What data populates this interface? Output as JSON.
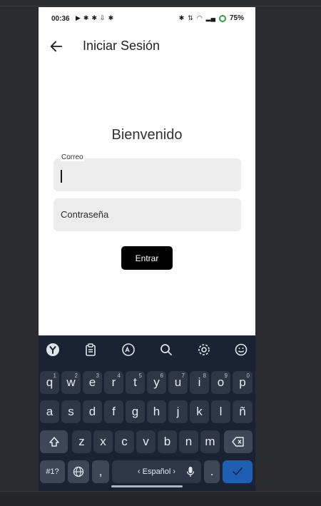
{
  "status": {
    "time": "00:36",
    "battery": "75%"
  },
  "appbar": {
    "title": "Iniciar Sesión"
  },
  "main": {
    "welcome": "Bienvenido",
    "email_label": "Correo",
    "password_placeholder": "Contraseña",
    "submit_label": "Entrar"
  },
  "keyboard": {
    "row1": [
      {
        "k": "q",
        "s": "1"
      },
      {
        "k": "w",
        "s": "2"
      },
      {
        "k": "e",
        "s": "3"
      },
      {
        "k": "r",
        "s": "4"
      },
      {
        "k": "t",
        "s": "5"
      },
      {
        "k": "y",
        "s": "6"
      },
      {
        "k": "u",
        "s": "7"
      },
      {
        "k": "i",
        "s": "8"
      },
      {
        "k": "o",
        "s": "9"
      },
      {
        "k": "p",
        "s": "0"
      }
    ],
    "row2": [
      "a",
      "s",
      "d",
      "f",
      "g",
      "h",
      "j",
      "k",
      "l",
      "ñ"
    ],
    "row3": [
      "z",
      "x",
      "c",
      "v",
      "b",
      "n",
      "m"
    ],
    "symbols_label": "#1?",
    "comma": ",",
    "space_label": "‹ Español ›",
    "period": "."
  },
  "colors": {
    "accent": "#1e5fb3",
    "keyboard_bg": "#1b2233",
    "button_bg": "#000000"
  }
}
